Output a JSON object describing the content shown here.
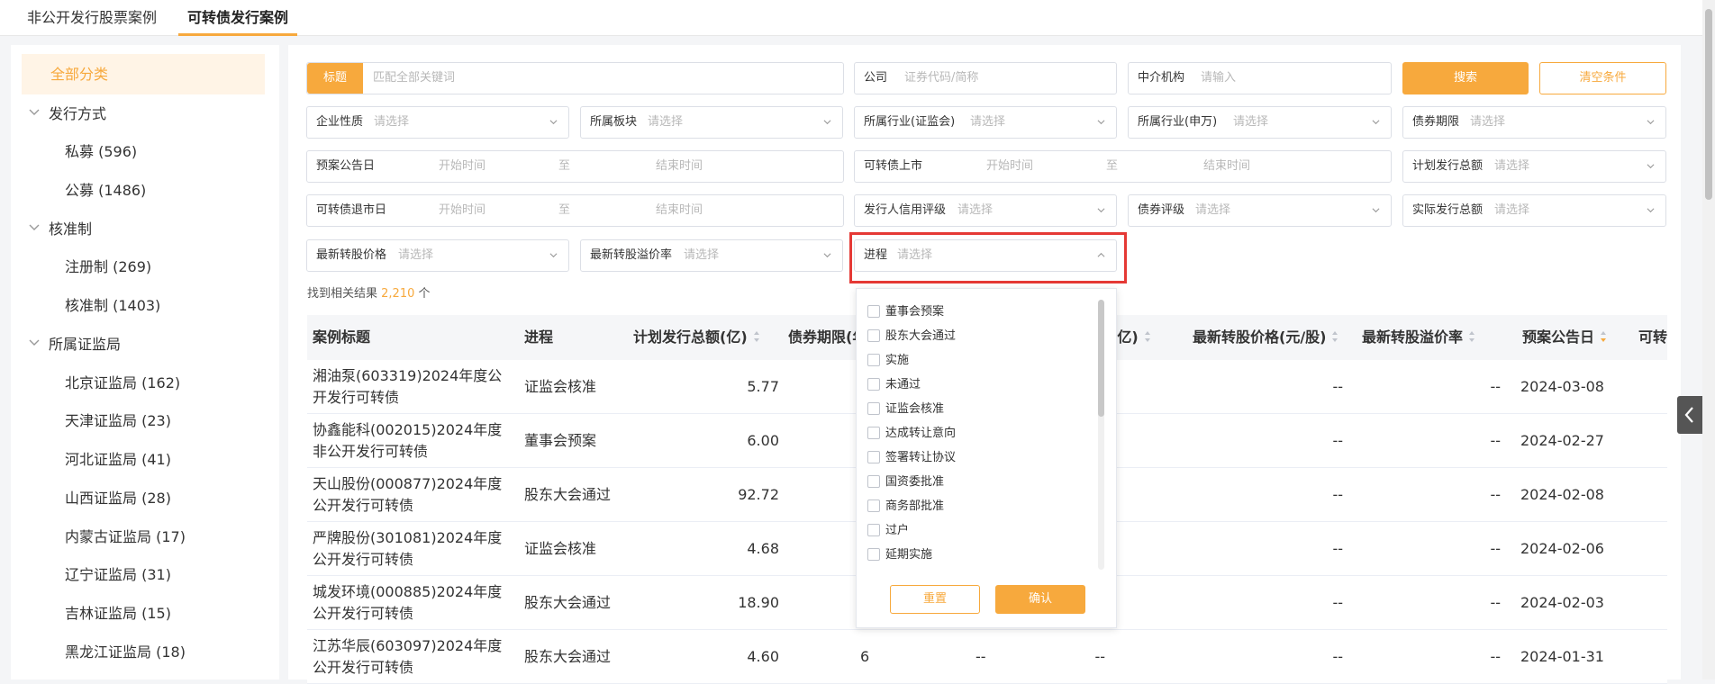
{
  "tabs": [
    {
      "label": "非公开发行股票案例"
    },
    {
      "label": "可转债发行案例"
    }
  ],
  "sidebar": {
    "all_label": "全部分类",
    "groups": [
      {
        "label": "发行方式",
        "items": [
          "私募 (596)",
          "公募 (1486)"
        ]
      },
      {
        "label": "核准制",
        "items": [
          "注册制 (269)",
          "核准制 (1403)"
        ]
      },
      {
        "label": "所属证监局",
        "items": [
          "北京证监局 (162)",
          "天津证监局 (23)",
          "河北证监局 (41)",
          "山西证监局 (28)",
          "内蒙古证监局 (17)",
          "辽宁证监局 (31)",
          "吉林证监局 (15)",
          "黑龙江证监局 (18)"
        ]
      }
    ]
  },
  "filters": {
    "title_tag": "标题",
    "title_placeholder": "匹配全部关键词",
    "company_label": "公司",
    "company_placeholder": "证券代码/简称",
    "agency_label": "中介机构",
    "agency_placeholder": "请输入",
    "search_button": "搜索",
    "clear_button": "清空条件",
    "select_placeholder": "请选择",
    "start_placeholder": "开始时间",
    "end_placeholder": "结束时间",
    "range_sep": "至",
    "enterprise_nature": "企业性质",
    "board": "所属板块",
    "industry_csrc": "所属行业(证监会)",
    "industry_sw": "所属行业(申万)",
    "bond_term": "债券期限",
    "plan_date": "预案公告日",
    "listing": "可转债上市",
    "plan_amount": "计划发行总额",
    "delisting": "可转债退市日",
    "issuer_rating": "发行人信用评级",
    "bond_rating": "债券评级",
    "actual_amount": "实际发行总额",
    "latest_price": "最新转股价格",
    "latest_premium": "最新转股溢价率",
    "progress": "进程"
  },
  "results": {
    "prefix": "找到相关结果 ",
    "count": "2,210",
    "suffix": " 个"
  },
  "table": {
    "headers": [
      "案例标题",
      "进程",
      "计划发行总额(亿)",
      "债券期限(年)",
      "(亿)",
      "最新转股价格(元/股)",
      "最新转股溢价率",
      "预案公告日",
      "可转"
    ],
    "rows": [
      {
        "title": "湘油泵(603319)2024年度公开发行可转债",
        "progress": "证监会核准",
        "amount": "5.77",
        "term": "",
        "c5": "",
        "c6": "--",
        "price": "--",
        "premium": "--",
        "date": "2024-03-08"
      },
      {
        "title": "协鑫能科(002015)2024年度非公开发行可转债",
        "progress": "董事会预案",
        "amount": "6.00",
        "term": "",
        "c5": "",
        "c6": "--",
        "price": "--",
        "premium": "--",
        "date": "2024-02-27"
      },
      {
        "title": "天山股份(000877)2024年度公开发行可转债",
        "progress": "股东大会通过",
        "amount": "92.72",
        "term": "",
        "c5": "",
        "c6": "--",
        "price": "--",
        "premium": "--",
        "date": "2024-02-08"
      },
      {
        "title": "严牌股份(301081)2024年度公开发行可转债",
        "progress": "证监会核准",
        "amount": "4.68",
        "term": "",
        "c5": "",
        "c6": "--",
        "price": "--",
        "premium": "--",
        "date": "2024-02-06"
      },
      {
        "title": "城发环境(000885)2024年度公开发行可转债",
        "progress": "股东大会通过",
        "amount": "18.90",
        "term": "",
        "c5": "",
        "c6": "--",
        "price": "--",
        "premium": "--",
        "date": "2024-02-03"
      },
      {
        "title": "江苏华辰(603097)2024年度公开发行可转债",
        "progress": "股东大会通过",
        "amount": "4.60",
        "term": "6",
        "c5": "--",
        "c6": "--",
        "price": "--",
        "premium": "--",
        "date": "2024-01-31"
      }
    ]
  },
  "popup": {
    "options": [
      "董事会预案",
      "股东大会通过",
      "实施",
      "未通过",
      "证监会核准",
      "达成转让意向",
      "签署转让协议",
      "国资委批准",
      "商务部批准",
      "过户",
      "延期实施"
    ],
    "reset": "重置",
    "confirm": "确认"
  },
  "colors": {
    "accent": "#f7a93d",
    "highlight": "#e53935"
  }
}
